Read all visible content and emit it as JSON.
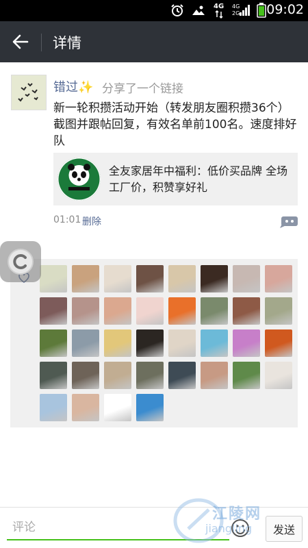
{
  "status_bar": {
    "time": "09:02",
    "network_primary": "4G",
    "network_secondary": "4G\n2G",
    "icons": [
      "alarm-icon",
      "image-icon",
      "signal-icon",
      "battery-icon"
    ]
  },
  "action_bar": {
    "back_icon": "arrow-left-icon",
    "title": "详情"
  },
  "post": {
    "author": "错过✨",
    "share_note": "分享了一个链接",
    "text": "新一轮积攒活动开始（转发朋友圈积攒36个）截图并跟帖回复，有效名单前100名。速度排好队",
    "link": {
      "title": "全友家居年中福利：低价买品牌 全场工厂价，积赞享好礼",
      "thumb_icon": "panda-logo-icon"
    },
    "time": "01:01",
    "delete_label": "删除",
    "comment_icon": "comment-bubble-icon"
  },
  "likes": {
    "heart_icon": "heart-outline-icon",
    "count": 36,
    "avatar_colors": [
      "#d9dcc4",
      "#c9a27e",
      "#e6dccf",
      "#6e5245",
      "#d8c7a9",
      "#3b2a22",
      "#c7b8b2",
      "#d7a79c",
      "#7d5b5a",
      "#b5938b",
      "#dba88f",
      "#f0d4cf",
      "#e9702a",
      "#7a8a6c",
      "#8e5a46",
      "#a3a88b",
      "#5d7a3a",
      "#8c9ba8",
      "#e2c77a",
      "#2b2622",
      "#e0d5c7",
      "#6cbad8",
      "#c77fc9",
      "#d0591f",
      "#4f5a52",
      "#6e6358",
      "#c1ad92",
      "#6d6f5e",
      "#3e4b55",
      "#c79a84",
      "#5f8a4a",
      "#e9e4de",
      "#a8c4de",
      "#d9b6a0",
      "#ffffff",
      "#3b8ccf"
    ]
  },
  "comment_bar": {
    "placeholder": "评论",
    "emoji_icon": "smiley-icon",
    "send_label": "发送"
  },
  "watermark": {
    "text": "江陵网",
    "sub": "jiangling"
  }
}
